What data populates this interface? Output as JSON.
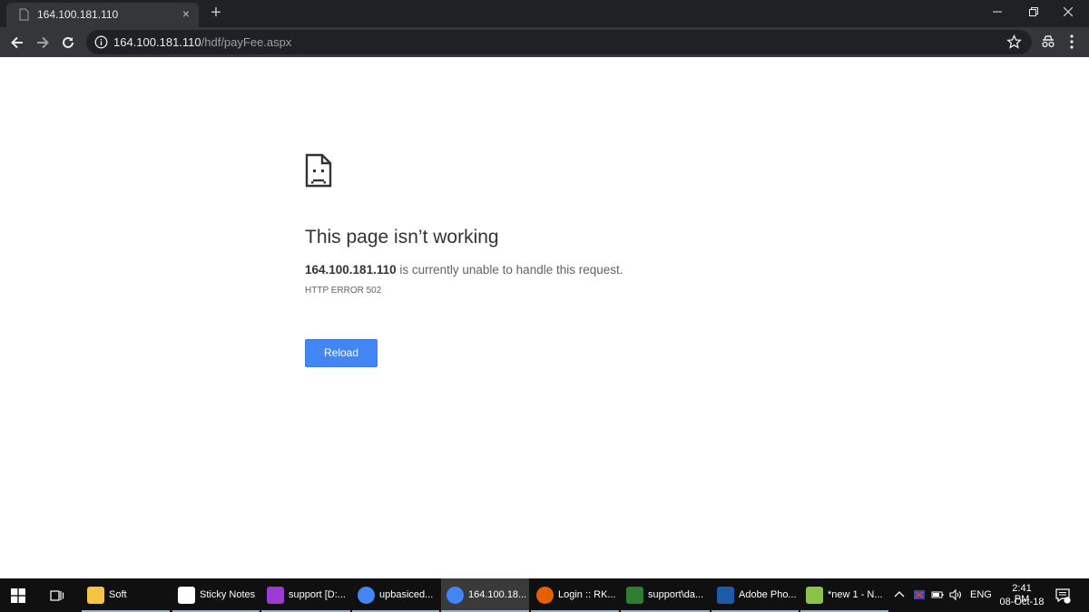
{
  "browser": {
    "tab_title": "164.100.181.110",
    "tab_close": "×",
    "new_tab": "+",
    "url_host": "164.100.181.110",
    "url_path": "/hdf/payFee.aspx"
  },
  "error_page": {
    "headline": "This page isn’t working",
    "host": "164.100.181.110",
    "message": " is currently unable to handle this request.",
    "error_code": "HTTP ERROR 502",
    "reload_label": "Reload"
  },
  "taskbar": {
    "items": [
      {
        "label": "Soft",
        "icon": "folder-icon",
        "color": "#f4c542"
      },
      {
        "label": "Sticky Notes",
        "icon": "sticky-notes-icon",
        "color": "#ffffff"
      },
      {
        "label": "support [D:...",
        "icon": "phpstorm-icon",
        "color": "#9b3bd1"
      },
      {
        "label": "upbasiced...",
        "icon": "chrome-icon",
        "color": "#4285f4"
      },
      {
        "label": "164.100.18...",
        "icon": "chrome-icon",
        "color": "#4285f4"
      },
      {
        "label": "Login :: RK...",
        "icon": "firefox-icon",
        "color": "#e66000"
      },
      {
        "label": "support\\da...",
        "icon": "heidisql-icon",
        "color": "#2e7d32"
      },
      {
        "label": "Adobe Pho...",
        "icon": "photoviewer-icon",
        "color": "#1e5aa8"
      },
      {
        "label": "*new 1 - N...",
        "icon": "notepadpp-icon",
        "color": "#8bc34a"
      }
    ],
    "active_index": 4,
    "lang": "ENG",
    "time": "2:41 PM",
    "date": "08-Oct-18"
  },
  "colors": {
    "accent": "#4285f4",
    "chrome_dark": "#202124",
    "chrome_toolbar": "#35363a"
  }
}
